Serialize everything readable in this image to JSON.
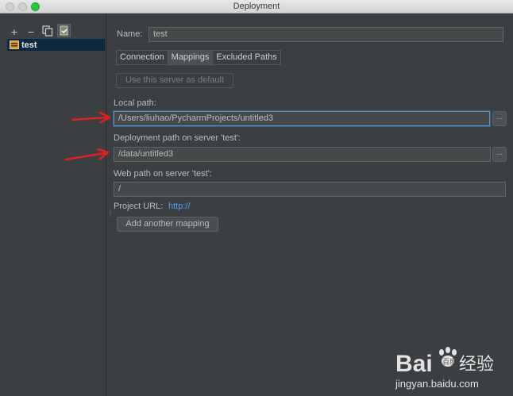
{
  "window": {
    "title": "Deployment"
  },
  "sidebar": {
    "toolbar": {
      "add": "+",
      "remove": "−"
    },
    "servers": [
      {
        "name": "test"
      }
    ]
  },
  "form": {
    "name_label": "Name:",
    "name_value": "test",
    "tabs": [
      {
        "label": "Connection",
        "active": false
      },
      {
        "label": "Mappings",
        "active": true
      },
      {
        "label": "Excluded Paths",
        "active": false
      }
    ],
    "default_button": "Use this server as default",
    "local_path_label": "Local path:",
    "local_path_value": "/Users/liuhao/PycharmProjects/untitled3",
    "deploy_path_label": "Deployment path on server 'test':",
    "deploy_path_value": "/data/untitled3",
    "web_path_label": "Web path on server 'test':",
    "web_path_value": "/",
    "project_url_label": "Project URL:",
    "project_url_value": "http://",
    "add_mapping_button": "Add another mapping",
    "browse_label": "..."
  },
  "watermark": {
    "brand": "Bai",
    "brand2": "百度",
    "suffix": "经验",
    "url": "jingyan.baidu.com"
  },
  "colors": {
    "accent": "#589df6",
    "selection": "#0d293e",
    "annotation": "#e02020"
  }
}
